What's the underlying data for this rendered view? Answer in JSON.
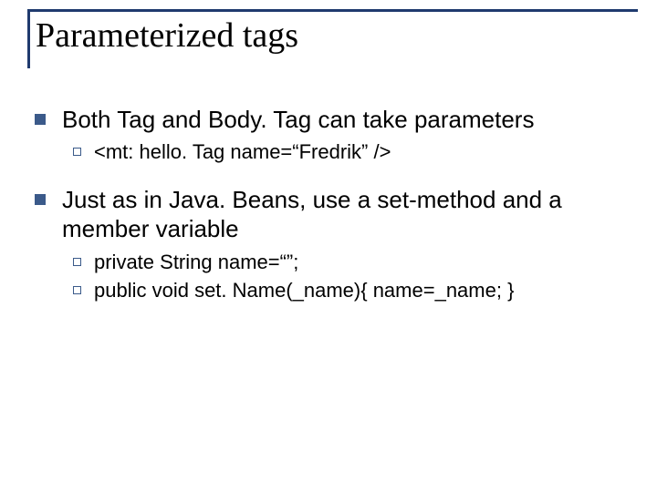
{
  "title": "Parameterized tags",
  "items": [
    {
      "text": "Both Tag and Body. Tag can take parameters",
      "sub": [
        {
          "text": "<mt: hello. Tag name=“Fredrik” />"
        }
      ]
    },
    {
      "text": "Just as in Java. Beans, use a set-method and a member variable",
      "sub": [
        {
          "text": "private String name=“”;"
        },
        {
          "text": "public void set. Name(_name){ name=_name; }"
        }
      ]
    }
  ]
}
